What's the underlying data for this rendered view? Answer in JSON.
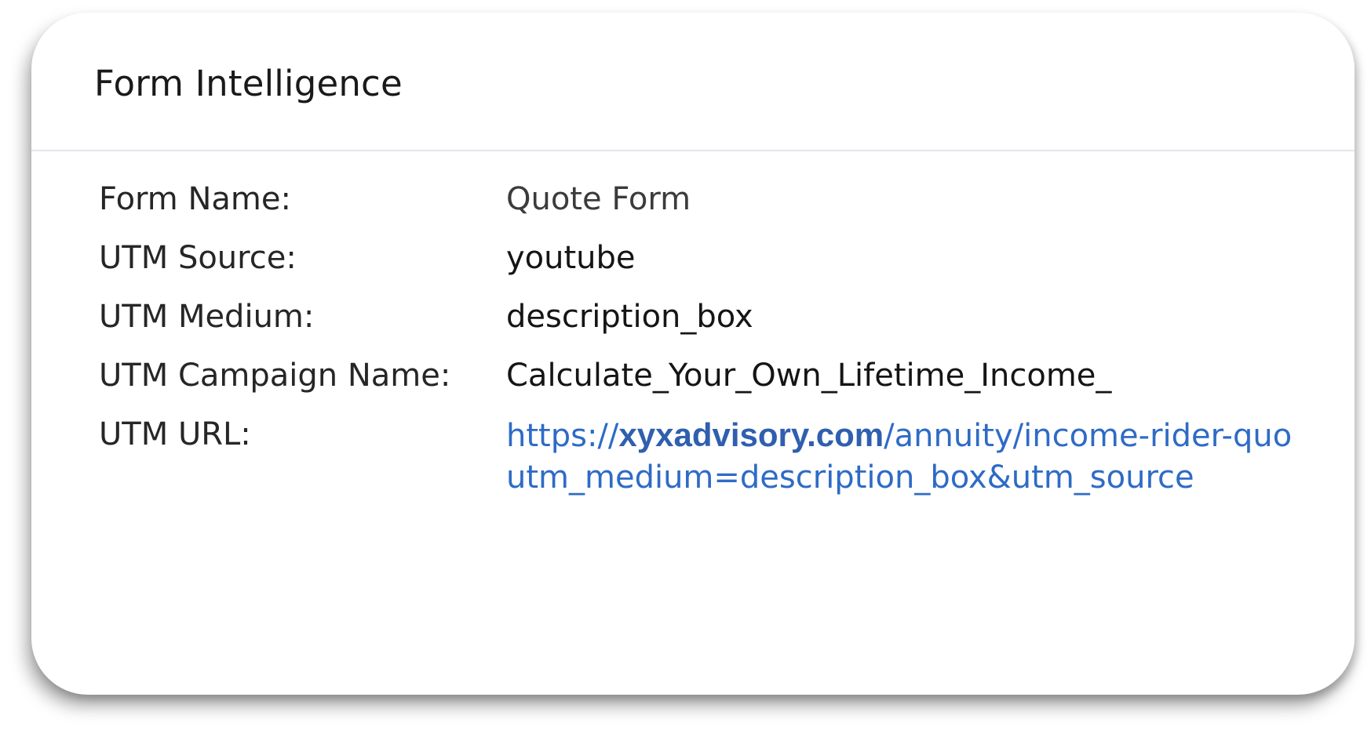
{
  "panel": {
    "title": "Form Intelligence"
  },
  "fields": {
    "form_name": {
      "label": "Form Name:",
      "value": "Quote Form"
    },
    "utm_source": {
      "label": "UTM Source:",
      "value": "youtube"
    },
    "utm_medium": {
      "label": "UTM Medium:",
      "value": "description_box"
    },
    "utm_campaign": {
      "label": "UTM Campaign Name:",
      "value": "Calculate_Your_Own_Lifetime_Income_"
    },
    "utm_url": {
      "label": "UTM URL:",
      "line1_prefix": "https://",
      "line1_domain": "xyxadvisory.com",
      "line1_rest": "/annuity/income-rider-quo",
      "line2": "utm_medium=description_box&utm_source"
    }
  },
  "colors": {
    "link": "#2e6bc6",
    "divider": "#e3e5ec",
    "text": "#262626"
  }
}
